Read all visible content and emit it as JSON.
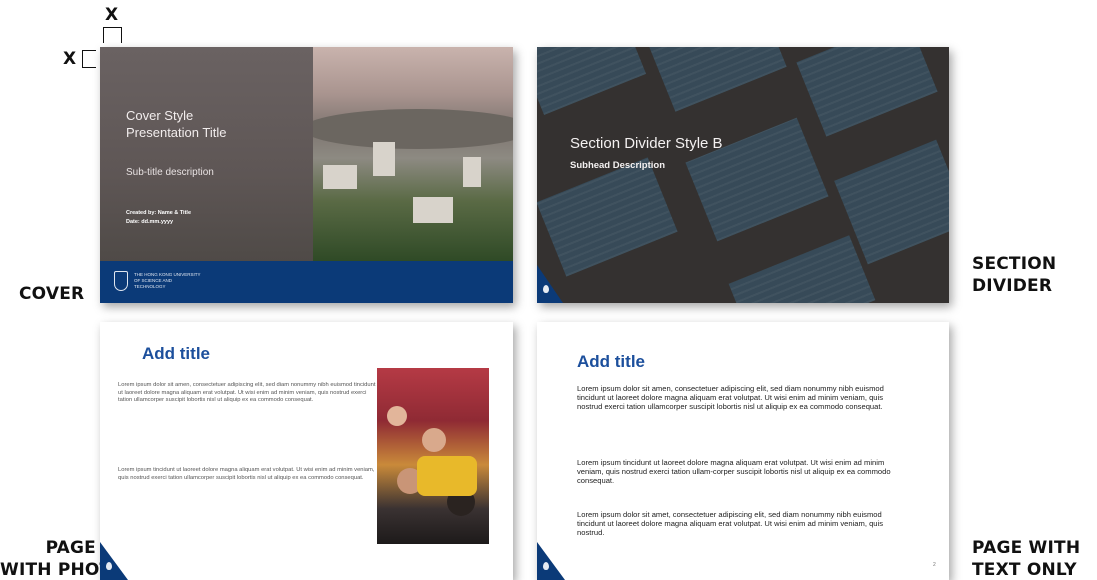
{
  "margin_marks": {
    "top": "X",
    "left": "X"
  },
  "labels": {
    "cover": "COVER",
    "section_divider": [
      "SECTION",
      "DIVIDER"
    ],
    "page_with_photo": [
      "PAGE",
      "WITH PHOTO"
    ],
    "page_with_text": [
      "PAGE WITH",
      "TEXT ONLY"
    ]
  },
  "cover_slide": {
    "title": "Cover Style\nPresentation Title",
    "subtitle": "Sub-title description",
    "created_by": "Created by: Name & Title",
    "date": "Date: dd.mm.yyyy",
    "university": "THE HONG KONG UNIVERSITY OF SCIENCE AND TECHNOLOGY"
  },
  "divider_slide": {
    "title": "Section Divider Style B",
    "subtitle": "Subhead Description"
  },
  "photo_slide": {
    "title": "Add title",
    "paragraphs": [
      "Lorem ipsum dolor sit amen, consectetuer adipiscing elit, sed diam nonummy nibh euismod tincidunt ut laoreet dolore magna aliquam erat volutpat. Ut wisi enim ad minim veniam, quis nostrud exerci tation ullamcorper suscipit lobortis nisl ut aliquip ex ea commodo consequat.",
      "Lorem ipsum tincidunt ut laoreet dolore magna aliquam erat volutpat. Ut wisi enim ad minim veniam, quis nostrud exerci tation ullamcorper suscipit lobortis nisl ut aliquip ex ea commodo consequat."
    ]
  },
  "text_slide": {
    "title": "Add title",
    "paragraphs": [
      "Lorem ipsum dolor sit amen, consectetuer adipiscing elit, sed diam nonummy nibh euismod tincidunt ut laoreet dolore magna aliquam erat volutpat. Ut wisi enim ad minim veniam, quis nostrud exerci tation ullamcorper suscipit lobortis nisl ut aliquip ex ea commodo consequat.",
      "Lorem ipsum tincidunt ut laoreet dolore magna aliquam erat volutpat. Ut wisi enim ad minim veniam, quis nostrud exerci tation ullam-corper suscipit lobortis nisl ut aliquip ex ea commodo consequat.",
      "Lorem ipsum dolor sit amet, consectetuer adipiscing elit, sed diam nonummy nibh euismod tincidunt ut laoreet dolore magna aliquam erat volutpat. Ut wisi enim ad minim veniam, quis nostrud."
    ],
    "page_number": "2"
  },
  "colors": {
    "brand_navy": "#0b3a78",
    "title_blue": "#1c4f9c"
  }
}
